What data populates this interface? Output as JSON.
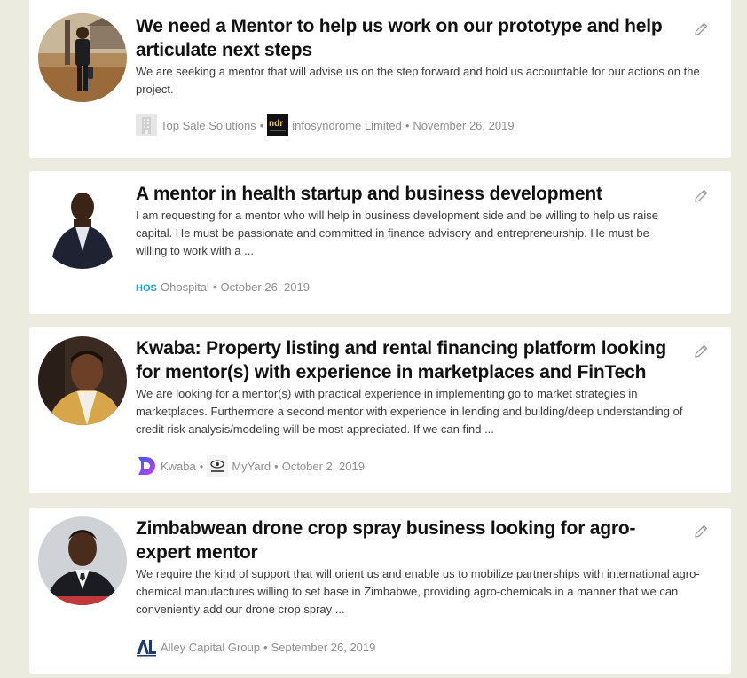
{
  "requests": [
    {
      "title": "We need a Mentor to help us work on our prototype and help articulate next steps",
      "description": "We are seeking a mentor that will advise us on the step forward and hold us accountable for our actions on the project.",
      "organizations": [
        "Top Sale Solutions",
        "infosyndrome Limited"
      ],
      "date": "November 26, 2019",
      "avatar_icon": "person-photo",
      "logo_icons": [
        "building-logo",
        "infosyndrome-logo"
      ]
    },
    {
      "title": "A mentor in health startup and business development",
      "description": "I am requesting for a mentor who will help in business development side and be willing to help us raise capital. He must be passionate and committed in finance advisory and entrepreneurship. He must be willing to work with a ...",
      "organizations": [
        "Ohospital"
      ],
      "date": "October 26, 2019",
      "avatar_icon": "person-photo",
      "logo_icons": [
        "ohospital-logo"
      ],
      "logo_text": "HOS"
    },
    {
      "title": "Kwaba: Property listing and rental financing platform looking for mentor(s) with experience in marketplaces and FinTech",
      "description": "We are looking for a mentor(s) with practical experience in implementing go to market strategies in marketplaces. Furthermore a second mentor with experience in lending and building/deep understanding of credit risk analysis/modeling will be most appreciated. If we can find ...",
      "organizations": [
        "Kwaba",
        "MyYard"
      ],
      "date": "October 2, 2019",
      "avatar_icon": "person-photo",
      "logo_icons": [
        "kwaba-logo",
        "myyard-logo"
      ]
    },
    {
      "title": "Zimbabwean drone crop spray business looking for agro-expert mentor",
      "description": "We require the kind of support that will orient us and enable us to mobilize partnerships with international agro-chemical manufactures willing to set base in Zimbabwe, providing agro-chemicals in a manner that we can conveniently add our drone crop spray ...",
      "organizations": [
        "Alley Capital Group"
      ],
      "date": "September 26, 2019",
      "avatar_icon": "person-photo",
      "logo_icons": [
        "alley-capital-logo"
      ]
    }
  ],
  "separator": "•",
  "edit_icon": "pencil-icon",
  "colors": {
    "page_background": "#ebecdf",
    "card_background": "#ffffff",
    "title_text": "#111111",
    "meta_text": "#8f8f8f",
    "kwaba_gradient_start": "#3a5bff",
    "kwaba_gradient_end": "#c43cf0",
    "ohospital_blue": "#1aa5d6",
    "alley_navy": "#1c3a6e"
  }
}
